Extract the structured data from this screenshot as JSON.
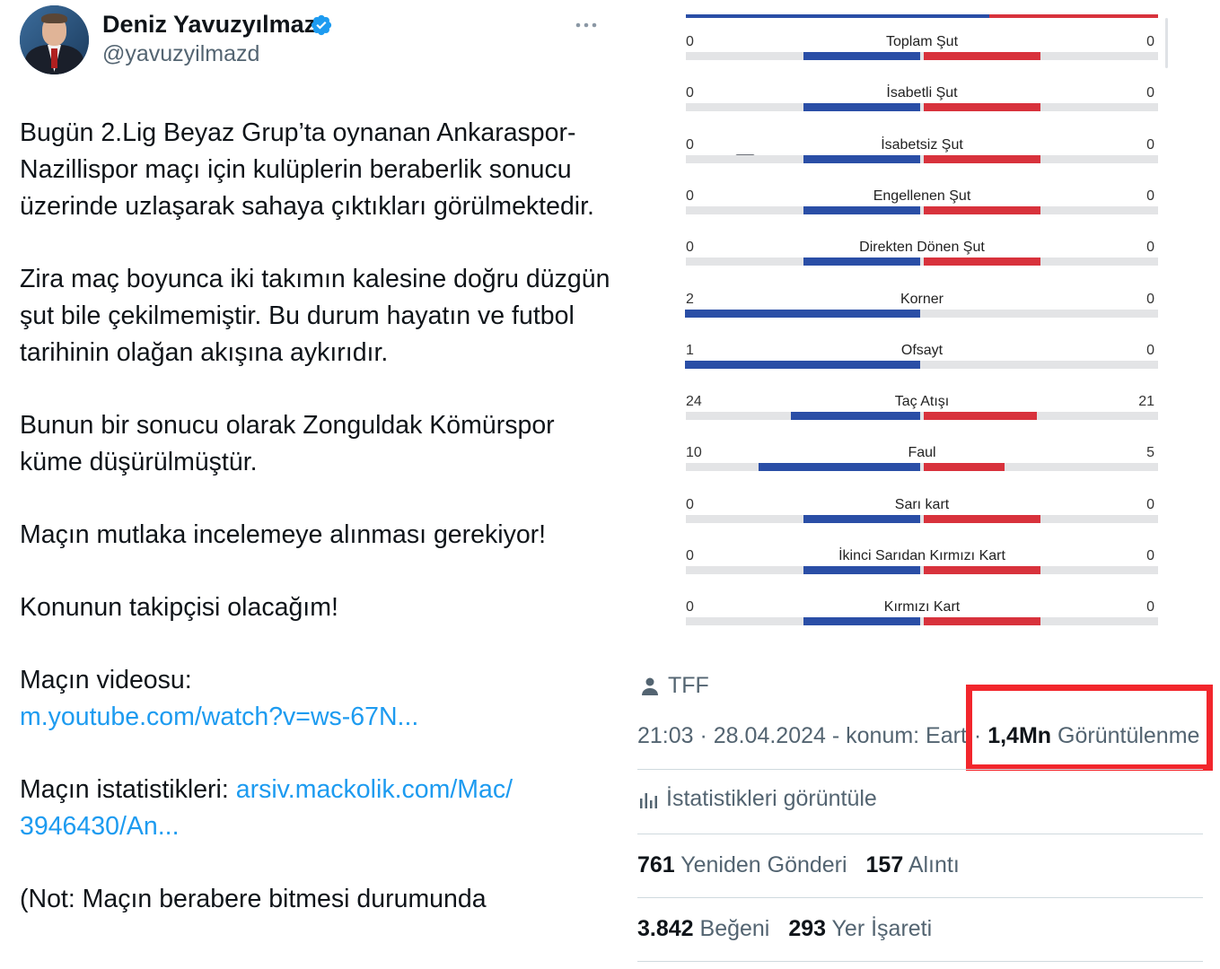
{
  "author": {
    "name": "Deniz Yavuzyılmaz",
    "handle": "@yavuzyilmazd"
  },
  "tweet": {
    "p1": "Bugün 2.Lig Beyaz Grup’ta oynanan Ankaraspor-Nazillispor maçı için kulüplerin beraberlik sonucu üzerinde uzlaşarak sahaya çıktıkları görülmektedir.",
    "p2": "Zira maç boyunca iki takımın kalesine doğru düzgün şut bile çekilmemiştir. Bu durum hayatın ve futbol tarihinin olağan akışına aykırıdır.",
    "p3": "Bunun bir sonucu olarak Zonguldak Kömürspor küme düşürülmüştür.",
    "p4": "Maçın mutlaka incelemeye alınması gerekiyor!",
    "p5": "Konunun takipçisi olacağım!",
    "video_label": "Maçın videosu:",
    "video_link": "m.youtube.com/watch?v=ws-67N...",
    "stats_label": "Maçın istatistikleri:",
    "stats_link_a": "arsiv.mackolik.com/Mac/",
    "stats_link_b": "3946430/An...",
    "note": "(Not: Maçın berabere bitmesi durumunda"
  },
  "chart_data": {
    "type": "table",
    "rows": [
      {
        "label": "Toplam Şut",
        "home": 0,
        "away": 0
      },
      {
        "label": "İsabetli Şut",
        "home": 0,
        "away": 0
      },
      {
        "label": "İsabetsiz Şut",
        "home": 0,
        "away": 0
      },
      {
        "label": "Engellenen Şut",
        "home": 0,
        "away": 0
      },
      {
        "label": "Direkten Dönen Şut",
        "home": 0,
        "away": 0
      },
      {
        "label": "Korner",
        "home": 2,
        "away": 0
      },
      {
        "label": "Ofsayt",
        "home": 1,
        "away": 0
      },
      {
        "label": "Taç Atışı",
        "home": 24,
        "away": 21
      },
      {
        "label": "Faul",
        "home": 10,
        "away": 5
      },
      {
        "label": "Sarı kart",
        "home": 0,
        "away": 0
      },
      {
        "label": "İkinci Sarıdan Kırmızı Kart",
        "home": 0,
        "away": 0
      },
      {
        "label": "Kırmızı Kart",
        "home": 0,
        "away": 0
      }
    ],
    "colors": {
      "home": "#2a4ea6",
      "away": "#d8323c"
    }
  },
  "post_meta": {
    "source": "TFF",
    "time": "21:03",
    "date": "28.04.2024",
    "location_prefix": "- konum: Eart",
    "views_count": "1,4Mn",
    "views_label": "Görüntülenme",
    "analytics_label": "İstatistikleri görüntüle",
    "reposts_count": "761",
    "reposts_label": "Yeniden Gönderi",
    "quotes_count": "157",
    "quotes_label": "Alıntı",
    "likes_count": "3.842",
    "likes_label": "Beğeni",
    "bookmarks_count": "293",
    "bookmarks_label": "Yer İşareti"
  },
  "colors": {
    "link": "#1d9bf0",
    "highlight": "#f2262c",
    "verified": "#1d9bf0"
  }
}
